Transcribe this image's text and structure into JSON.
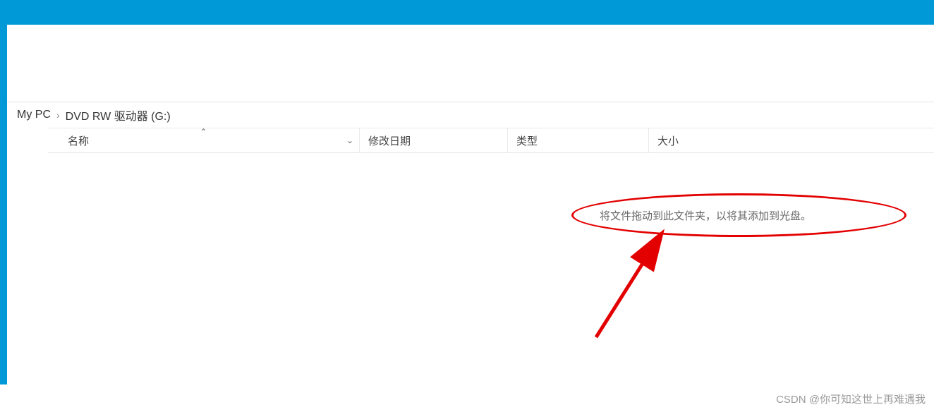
{
  "breadcrumb": {
    "root": "My PC",
    "current": "DVD RW 驱动器 (G:)"
  },
  "columns": {
    "name": "名称",
    "date": "修改日期",
    "type": "类型",
    "size": "大小"
  },
  "content": {
    "hint": "将文件拖动到此文件夹，以将其添加到光盘。"
  },
  "watermark": "CSDN @你可知这世上再难遇我",
  "annotation": {
    "ellipse_color": "#e30000",
    "arrow_color": "#e30000"
  }
}
